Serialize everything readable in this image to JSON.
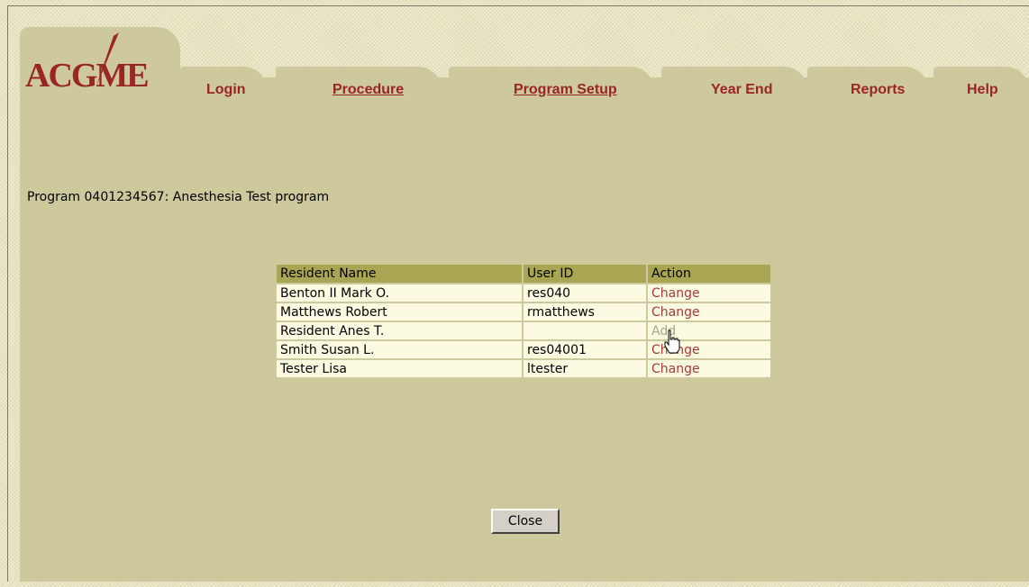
{
  "logo": {
    "text": "ACGME"
  },
  "nav": {
    "tabs": [
      {
        "label": "Login",
        "linked": false
      },
      {
        "label": "Procedure",
        "linked": true
      },
      {
        "label": "Program Setup",
        "linked": true
      },
      {
        "label": "Year End",
        "linked": false
      },
      {
        "label": "Reports",
        "linked": false
      },
      {
        "label": "Help",
        "linked": false
      }
    ]
  },
  "program": {
    "text": "Program 0401234567:  Anesthesia Test program"
  },
  "table": {
    "headers": [
      "Resident Name",
      "User ID",
      "Action"
    ],
    "rows": [
      {
        "name": "Benton II Mark O.",
        "user_id": "res040",
        "action": "Change",
        "action_enabled": true
      },
      {
        "name": "Matthews Robert",
        "user_id": "rmatthews",
        "action": "Change",
        "action_enabled": true
      },
      {
        "name": "Resident Anes T.",
        "user_id": "",
        "action": "Add",
        "action_enabled": false
      },
      {
        "name": "Smith Susan L.",
        "user_id": "res04001",
        "action": "Change",
        "action_enabled": true
      },
      {
        "name": "Tester Lisa",
        "user_id": "ltester",
        "action": "Change",
        "action_enabled": true
      }
    ]
  },
  "close_button": {
    "label": "Close"
  },
  "colors": {
    "panel": "#cdc99d",
    "header": "#a8a653",
    "row": "#fcfae0",
    "accent": "#9a2525",
    "disabled": "#a8a68a"
  }
}
